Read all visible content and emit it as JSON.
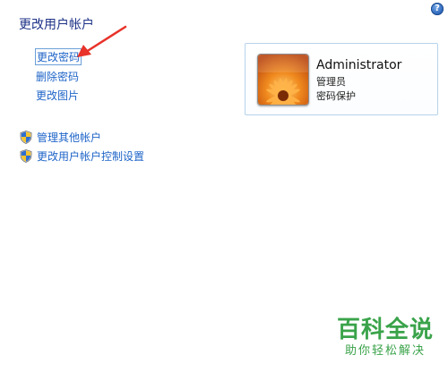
{
  "header": {
    "help_glyph": "?"
  },
  "page_title": "更改用户帐户",
  "tasks": [
    {
      "label": "更改密码"
    },
    {
      "label": "删除密码"
    },
    {
      "label": "更改图片"
    }
  ],
  "shield_links": [
    {
      "label": "管理其他帐户",
      "icon": "uac-shield-icon"
    },
    {
      "label": "更改用户帐户控制设置",
      "icon": "uac-shield-icon"
    }
  ],
  "account": {
    "name": "Administrator",
    "role": "管理员",
    "status": "密码保护",
    "picture": "flower-avatar"
  },
  "annotation": {
    "color": "#e8322a"
  },
  "watermark": {
    "title": "百科全说",
    "subtitle": "助你轻松解决",
    "color": "#3aa34a"
  },
  "colors": {
    "link": "#1e64c8",
    "title": "#1e3287"
  }
}
